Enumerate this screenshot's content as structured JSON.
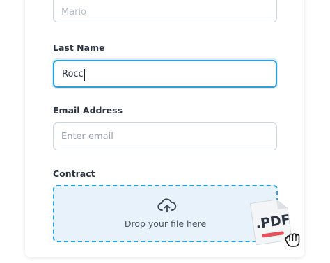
{
  "form": {
    "first_name_value": "Mario",
    "last_name_label": "Last Name",
    "last_name_value": "Rocc",
    "email_label": "Email Address",
    "email_placeholder": "Enter email",
    "contract_label": "Contract",
    "dropzone_text": "Drop your file here"
  },
  "file_drag": {
    "file_label": ".PDF"
  },
  "icons": {
    "upload": "cloud-upload-icon",
    "file": "pdf-file-icon",
    "cursor": "grab-hand-cursor-icon"
  },
  "colors": {
    "accent": "#2aa0de",
    "dropzone_bg": "#e8f2fb",
    "pdf_stripe": "#e8505b"
  }
}
